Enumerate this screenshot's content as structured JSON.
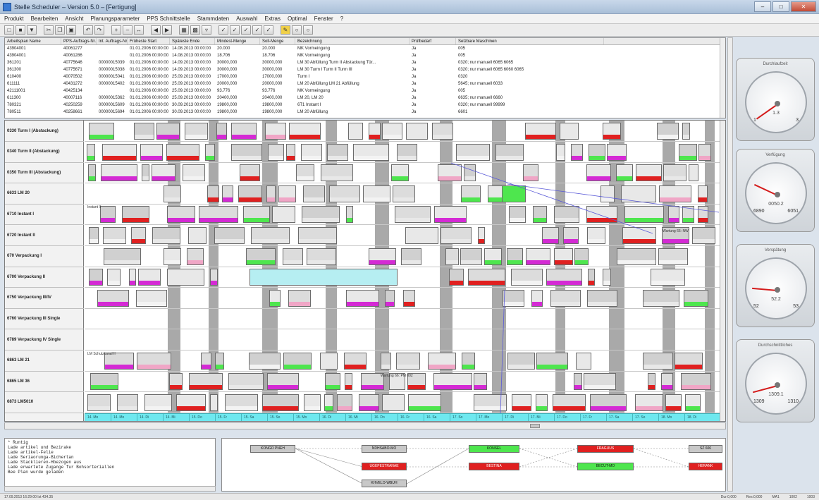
{
  "window": {
    "title": "Stelle Scheduler – Version 5.0 – [Fertigung]"
  },
  "menu": [
    "Produkt",
    "Bearbeiten",
    "Ansicht",
    "Planungsparameter",
    "PPS Schnittstelle",
    "Stammdaten",
    "Auswahl",
    "Extras",
    "Optimal",
    "Fenster",
    "?"
  ],
  "order_table": {
    "columns": [
      "Arbeitsplan Name",
      "PPS-Auftrags-Nr.",
      "Int. Auftrags-Nr.",
      "Früheste Start",
      "Späteste Ende",
      "Mindest-Menge",
      "Soll-Menge",
      "Bezeichnung",
      "Prüfbedarf",
      "Setzbare Maschinen"
    ],
    "rows": [
      [
        "43904001",
        "40061277",
        "",
        "01.01.2006 00:00:00",
        "14.08.2013 00:00:00",
        "20.000",
        "20.000",
        "MK Vormeingung",
        "Ja",
        "005"
      ],
      [
        "43904001",
        "40061286",
        "",
        "01.01.2006 00:00:00",
        "14.08.2013 00:00:00",
        "18.706",
        "18.706",
        "MK Vormeingung",
        "Ja",
        "005"
      ],
      [
        "361201",
        "40775646",
        "00000015039",
        "01.01.2006 00:00:00",
        "14.09.2013 00:00:00",
        "30000,000",
        "30000,000",
        "LM 30 Abfüllung Turm II Abstackung Tür...",
        "Ja",
        "0320; nur manuell 6065 6065"
      ],
      [
        "361300",
        "40775671",
        "00000015038",
        "01.01.2006 00:00:00",
        "14.09.2013 00:00:00",
        "30000,000",
        "30000,000",
        "LM 30 Turm I Turm II Turm III",
        "Ja",
        "0320; nur manuell 6065 6060 6065"
      ],
      [
        "610400",
        "40070502",
        "00000015041",
        "01.01.2006 00:00:00",
        "25.09.2013 00:00:00",
        "17000,000",
        "17000,000",
        "Turm I",
        "Ja",
        "0320"
      ],
      [
        "611111",
        "40431272",
        "00000015402",
        "01.01.2006 00:00:00",
        "25.09.2013 00:00:00",
        "20000,000",
        "20000,000",
        "LM 20 Abfüllung LM 21 Abfüllung",
        "Ja",
        "5645; nur manuell 6033"
      ],
      [
        "42111001",
        "40425134",
        "",
        "01.01.2006 00:00:00",
        "25.09.2013 00:00:00",
        "93.776",
        "93.776",
        "MK Vormeingung",
        "Ja",
        "005"
      ],
      [
        "611300",
        "40007116",
        "00000015362",
        "01.01.2006 00:00:00",
        "25.09.2013 00:00:00",
        "20400,000",
        "20400,000",
        "LM 20, LM 20",
        "Ja",
        "6635; nur manuell 6660"
      ],
      [
        "780321",
        "40250259",
        "00000015609",
        "01.01.2006 00:00:00",
        "30.09.2013 00:00:00",
        "19800,000",
        "19800,000",
        "6T1 Instant I",
        "Ja",
        "0320; nur manuell 99999"
      ],
      [
        "780511",
        "40258661",
        "00000015694",
        "01.01.2006 00:00:00",
        "30.09.2013 00:00:00",
        "19800,000",
        "19800,000",
        "LM 20 Abfüllung",
        "Ja",
        "6601"
      ]
    ]
  },
  "resources": [
    "0330 Turm I (Abstackung)",
    "0340 Turm II (Abstackung)",
    "0350 Turm III (Abstackung)",
    "6633 LM 20",
    "6710 Instant I",
    "6720 Instant II",
    "670 Verpackung I",
    "6700 Verpackung II",
    "6750 Verpackung III/IV",
    "6760 Verpackung III Single",
    "6789 Verpackung IV Single",
    "6863 LM 21",
    "6865 LM 36",
    "6873 LM5010"
  ],
  "gantt_notes": {
    "n1": "Instant II",
    "n2": "Wartung 66: NW",
    "n3": "LM Schutzkanal II",
    "n4": "Wartung 66: PM 002"
  },
  "timeline": [
    "14. Mo",
    "14. Mo",
    "14. Di",
    "14. Mi",
    "15. Do",
    "15. Fr",
    "15. Sa",
    "15. So",
    "15. Mo",
    "16. Di",
    "16. Mi",
    "16. Do",
    "16. Fr",
    "16. Sa",
    "17. So",
    "17. Mo",
    "17. Di",
    "17. Mi",
    "17. Do",
    "17. Fr",
    "17. Sa",
    "17. So",
    "18. Mo",
    "18. Di"
  ],
  "log_lines": [
    "* Runtig",
    "Lade artikel und Bezirake",
    "Lade artikel-Felie",
    "Lade Seriaorunga-Bichertan",
    "Lade Stacklieren-Hbezogen aus",
    "Lade erwartete Zugange fur Bohsorteriallen",
    "Bee Plan wurde geladen"
  ],
  "flow_nodes": [
    {
      "label": "KONGO PNEH",
      "color": "grey"
    },
    {
      "label": "NDHSABO-MO",
      "color": "grey"
    },
    {
      "label": "KONSEL",
      "color": "green"
    },
    {
      "label": "FRAGUUS",
      "color": "red"
    },
    {
      "label": "SZ 606",
      "color": "grey"
    },
    {
      "label": "UGEPESTRANAE",
      "color": "red"
    },
    {
      "label": "BESTINA",
      "color": "red"
    },
    {
      "label": "BECUT-MO",
      "color": "green"
    },
    {
      "label": "HERANK",
      "color": "red"
    },
    {
      "label": "KHVELO-WBUH",
      "color": "grey"
    }
  ],
  "gauges": [
    {
      "title": "Durchlaufzeit",
      "value": "1.3",
      "min": "1",
      "max": "3",
      "needle_deg": -35
    },
    {
      "title": "Verfügung",
      "value": "0050.2",
      "min": "6890",
      "max": "6051",
      "needle_deg": 25
    },
    {
      "title": "Verspätung",
      "value": "52.2",
      "min": "52",
      "max": "53",
      "needle_deg": 5
    },
    {
      "title": "Durchschnittliches",
      "value": "1309.1",
      "min": "1309",
      "max": "1310",
      "needle_deg": -15
    }
  ],
  "status": {
    "left": "17.09.2013 16:29:00  Ist 434.35",
    "dur": "Dur:0,000",
    "res": "Res:0,000",
    "nav": "MA1",
    "p1": "1002",
    "p2": "1003"
  },
  "colors": {
    "cyan_timeline": "#6ee8ef",
    "grey_shift": "#a9a9a9",
    "red_block": "#e02020",
    "green_block": "#4ee64e",
    "magenta_block": "#d42ad4",
    "pink_block": "#f0a6c6"
  }
}
